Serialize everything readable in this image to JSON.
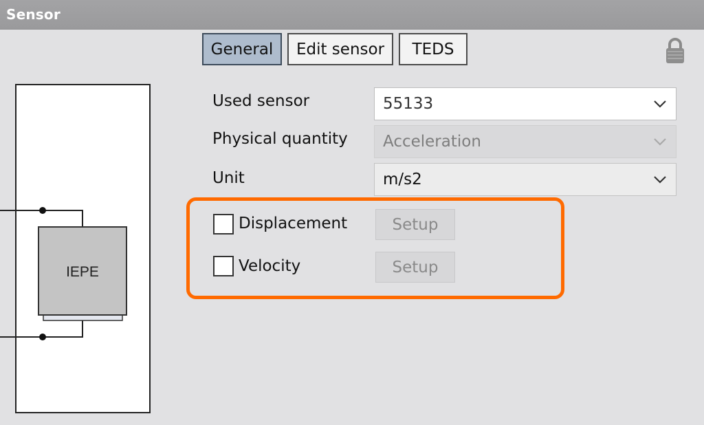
{
  "window": {
    "title": "Sensor"
  },
  "tabs": [
    {
      "label": "General",
      "active": true
    },
    {
      "label": "Edit sensor",
      "active": false
    },
    {
      "label": "TEDS",
      "active": false
    }
  ],
  "header_icons": {
    "lock": "lock-icon"
  },
  "diagram": {
    "block_label": "IEPE"
  },
  "form": {
    "used_sensor": {
      "label": "Used sensor",
      "value": "55133"
    },
    "physical_quantity": {
      "label": "Physical quantity",
      "value": "Acceleration",
      "enabled": false
    },
    "unit": {
      "label": "Unit",
      "value": "m/s2"
    }
  },
  "options": {
    "highlight_color": "#ff6a00",
    "displacement": {
      "label": "Displacement",
      "checked": false,
      "setup_label": "Setup",
      "setup_enabled": false
    },
    "velocity": {
      "label": "Velocity",
      "checked": false,
      "setup_label": "Setup",
      "setup_enabled": false
    }
  }
}
